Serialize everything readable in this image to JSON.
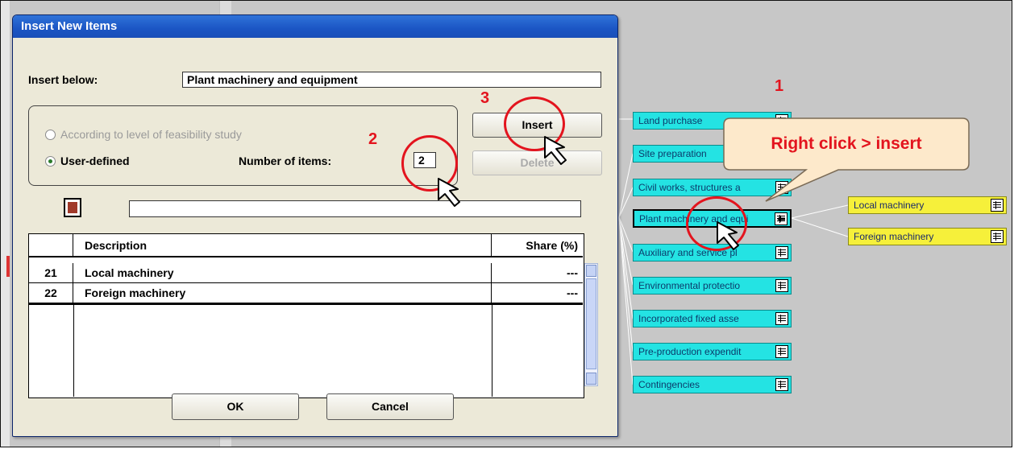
{
  "dialog": {
    "title": "Insert New Items",
    "insert_below_label": "Insert below:",
    "insert_below_value": "Plant machinery and equipment",
    "radio_feasibility_label": "According to level of feasibility study",
    "radio_user_defined_label": "User-defined",
    "number_of_items_label": "Number of items:",
    "number_of_items_value": "2",
    "insert_button": "Insert",
    "delete_button": "Delete",
    "ok_button": "OK",
    "cancel_button": "Cancel",
    "calculator_icon": "calculator-icon"
  },
  "table": {
    "columns": [
      "",
      "Description",
      "Share (%)"
    ],
    "rows": [
      {
        "num": "21",
        "description": "Local machinery",
        "share": "---"
      },
      {
        "num": "22",
        "description": "Foreign machinery",
        "share": "---"
      }
    ]
  },
  "tree": {
    "nodes": [
      {
        "label": "Land purchase"
      },
      {
        "label": "Site preparation"
      },
      {
        "label": "Civil works, structures a"
      },
      {
        "label": "Plant machinery and equi"
      },
      {
        "label": "Auxiliary and service pl"
      },
      {
        "label": "Environmental protectio"
      },
      {
        "label": "Incorporated fixed asse"
      },
      {
        "label": "Pre-production expendit"
      },
      {
        "label": "Contingencies"
      }
    ],
    "children": [
      {
        "label": "Local machinery"
      },
      {
        "label": "Foreign machinery"
      }
    ]
  },
  "annotations": {
    "step1": "1",
    "step2": "2",
    "step3": "3",
    "callout": "Right click > insert"
  },
  "colors": {
    "node_cyan": "#24e3e3",
    "node_yellow": "#f6f03a",
    "annotation_red": "#e3141e"
  }
}
